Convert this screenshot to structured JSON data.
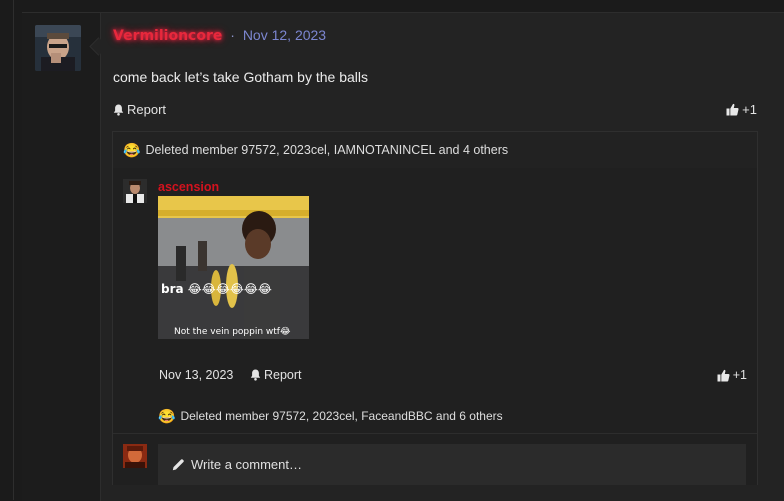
{
  "post": {
    "username": "Vermilioncore",
    "separator": "·",
    "date": "Nov 12, 2023",
    "message": "come back let’s take Gotham by the balls",
    "report_label": "Report",
    "like_count": "+1",
    "reactions_emoji": "😂",
    "reactions_text": "Deleted member 97572, 2023cel, IAMNOTANINCEL and 4 others"
  },
  "comment": {
    "username": "ascension",
    "image_caption_top": "bra 😂😂😂😂😂😂",
    "image_caption_bottom": "Not the vein poppin wtf😂",
    "date": "Nov 13, 2023",
    "report_label": "Report",
    "like_count": "+1",
    "reactions_emoji": "😂",
    "reactions_text": "Deleted member 97572, 2023cel, FaceandBBC and 6 others"
  },
  "composer": {
    "placeholder": "Write a comment…"
  },
  "icons": {
    "report": "bell-icon",
    "like": "thumbs-up-icon",
    "compose": "pencil-icon"
  },
  "colors": {
    "username_primary": "#e8283c",
    "date": "#7c86d0",
    "comment_username": "#d4121e"
  }
}
